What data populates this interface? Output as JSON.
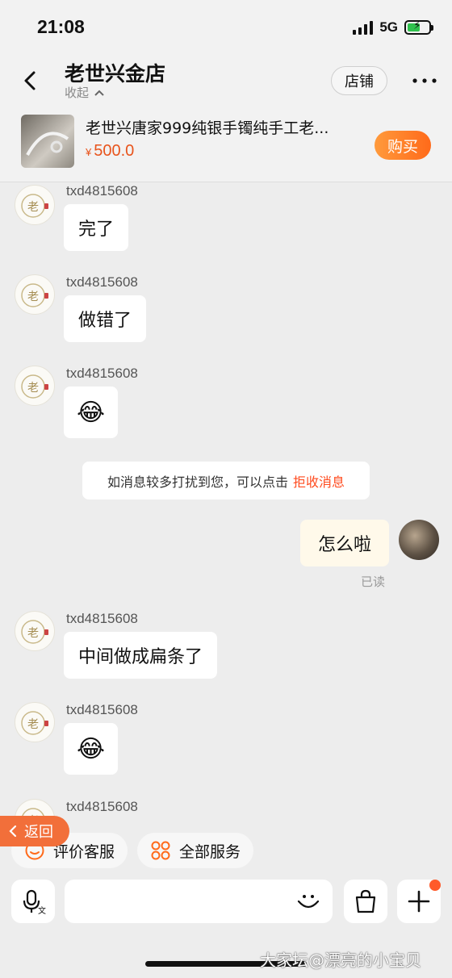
{
  "status": {
    "time": "21:08",
    "network": "5G"
  },
  "header": {
    "shop_name": "老世兴金店",
    "collapse_label": "收起",
    "store_button": "店铺"
  },
  "product": {
    "title": "老世兴唐家999纯银手镯纯手工老...",
    "currency": "¥",
    "price": "500.0",
    "buy_button": "购买"
  },
  "messages": [
    {
      "sender": "txd4815608",
      "text": "完了"
    },
    {
      "sender": "txd4815608",
      "text": "做错了"
    },
    {
      "sender": "txd4815608",
      "text": "😂"
    },
    {
      "sender": "txd4815608",
      "text": "中间做成扁条了"
    },
    {
      "sender": "txd4815608",
      "text": "😂"
    },
    {
      "sender": "txd4815608",
      "text": ""
    }
  ],
  "notice": {
    "text": "如消息较多打扰到您，可以点击",
    "link": "拒收消息"
  },
  "my_message": {
    "text": "怎么啦",
    "status": "已读"
  },
  "quick_actions": [
    {
      "label": "评价客服",
      "icon": "smile-badge-icon"
    },
    {
      "label": "全部服务",
      "icon": "grid-rings-icon"
    }
  ],
  "return_button": "返回",
  "input": {
    "placeholder": ""
  },
  "watermark": "大家坛@漂亮的小宝贝",
  "colors": {
    "accent": "#ff6a1a",
    "price": "#e8541c",
    "link": "#ff4b1f",
    "my_bubble": "#fff9ea"
  }
}
